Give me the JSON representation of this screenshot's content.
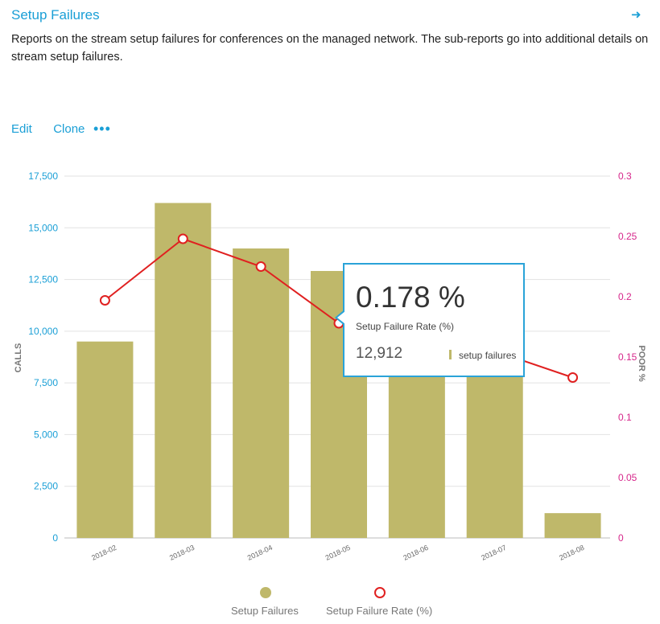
{
  "header": {
    "title": "Setup Failures",
    "description": "Reports on the stream setup failures for conferences on the managed network. The sub-reports go into additional details on stream setup failures."
  },
  "actions": {
    "edit": "Edit",
    "clone": "Clone",
    "more": "•••"
  },
  "colors": {
    "accent": "#1a9fd6",
    "bar": "#bfb86a",
    "line": "#e02020",
    "right_axis": "#d6278b"
  },
  "chart_data": {
    "type": "bar",
    "categories": [
      "2018-02",
      "2018-03",
      "2018-04",
      "2018-05",
      "2018-06",
      "2018-07",
      "2018-08"
    ],
    "series": [
      {
        "name": "Setup Failures",
        "type": "bar",
        "axis": "left",
        "values": [
          9500,
          16200,
          14000,
          12912,
          10400,
          9700,
          1200
        ]
      },
      {
        "name": "Setup Failure Rate (%)",
        "type": "line",
        "axis": "right",
        "values": [
          0.197,
          0.248,
          0.225,
          0.178,
          0.165,
          0.155,
          0.133
        ]
      }
    ],
    "ylabel": "CALLS",
    "y2label": "POOR %",
    "ylim": [
      0,
      17500
    ],
    "y2lim": [
      0,
      0.3
    ],
    "yticks": [
      "0",
      "2,500",
      "5,000",
      "7,500",
      "10,000",
      "12,500",
      "15,000",
      "17,500"
    ],
    "y2ticks": [
      "0",
      "0.05",
      "0.1",
      "0.15",
      "0.2",
      "0.25",
      "0.3"
    ],
    "grid": true,
    "legend": "bottom",
    "tooltip": {
      "rate": "0.178 %",
      "rate_label": "Setup Failure Rate (%)",
      "count": "12,912",
      "count_label": "setup failures"
    }
  }
}
